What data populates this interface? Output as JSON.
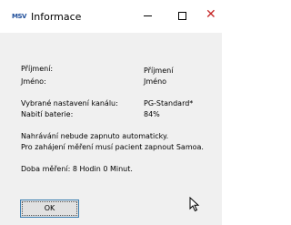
{
  "window": {
    "title": "Informace",
    "icon_text": "MSV",
    "icon_name": "app-logo-icon"
  },
  "fields": {
    "prijmeni_label": "Příjmení:",
    "prijmeni_value": "Příjmení",
    "jmeno_label": "Jméno:",
    "jmeno_value": "Jméno",
    "kanal_label": "Vybrané nastavení kanálu:",
    "kanal_value": "PG-Standard*",
    "baterie_label": "Nabití baterie:",
    "baterie_value": "84%"
  },
  "messages": {
    "line1": "Nahrávání nebude zapnuto automaticky.",
    "line2": "Pro zahájení měření musí pacient zapnout Samoa.",
    "duration": "Doba měření: 8 Hodin 0 Minut."
  },
  "buttons": {
    "ok": "OK"
  }
}
